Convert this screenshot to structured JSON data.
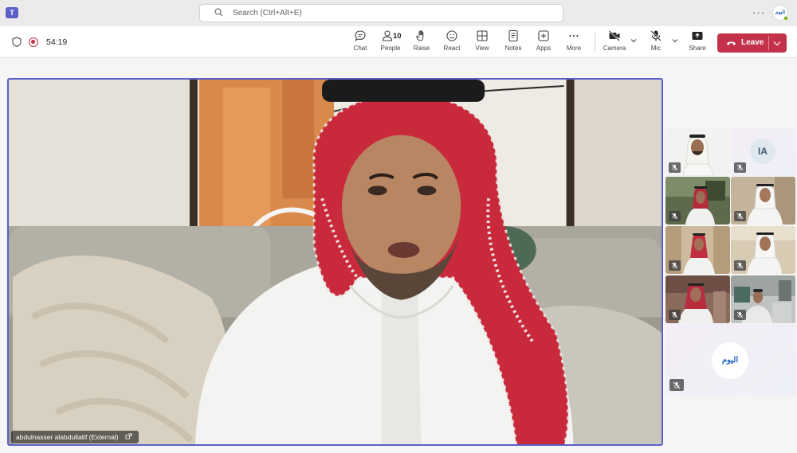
{
  "titlebar": {
    "search_placeholder": "Search (Ctrl+Alt+E)",
    "avatar_text": "اليوم"
  },
  "meeting": {
    "timer": "54:19"
  },
  "toolbar": {
    "chat": "Chat",
    "people": "People",
    "people_count": "10",
    "raise": "Raise",
    "react": "React",
    "view": "View",
    "notes": "Notes",
    "apps": "Apps",
    "more": "More",
    "camera": "Camera",
    "mic": "Mic",
    "share": "Share",
    "leave": "Leave"
  },
  "stage": {
    "speaker_name": "abdulnasser alabdullatif (External)"
  },
  "gallery": {
    "ia_initials": "IA",
    "logo_text": "اليوم"
  },
  "colors": {
    "accent": "#5b5fc7",
    "leave": "#c4314b"
  }
}
